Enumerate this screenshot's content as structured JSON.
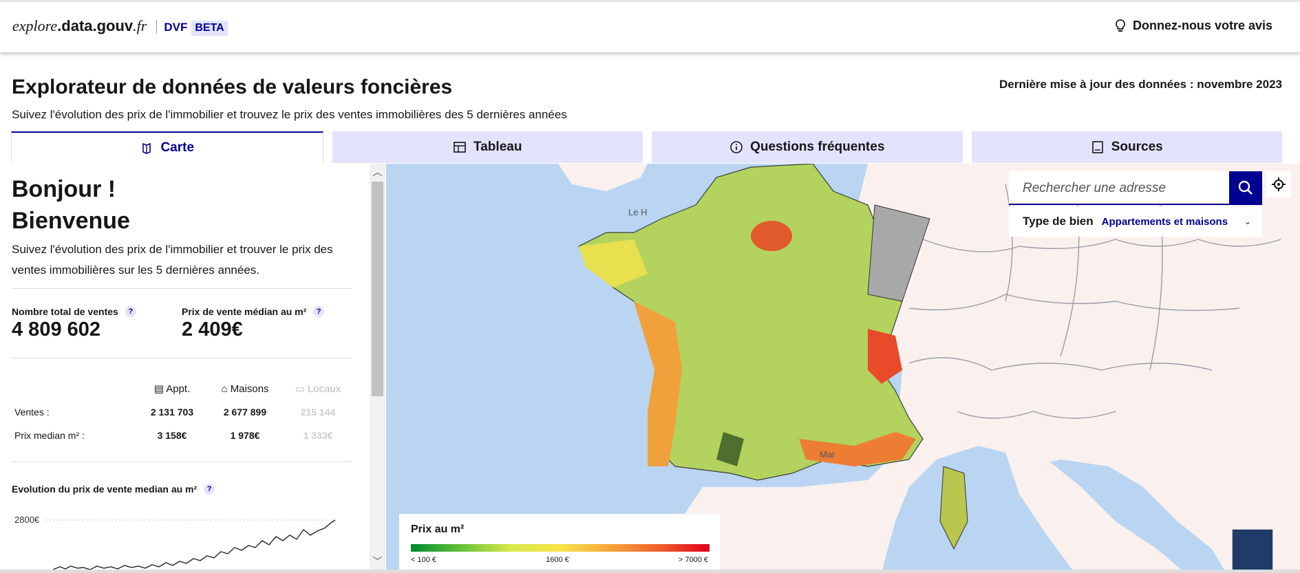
{
  "header": {
    "logo_italic": "explore",
    "logo_bold": ".data.gouv",
    "logo_suffix": ".fr",
    "product": "DVF",
    "badge": "BETA",
    "feedback": "Donnez-nous votre avis"
  },
  "page": {
    "title": "Explorateur de données de valeurs foncières",
    "subtitle": "Suivez l'évolution des prix de l'immobilier et trouvez le prix des ventes immobilières des 5 dernières années",
    "update_note": "Dernière mise à jour des données : novembre 2023"
  },
  "tabs": [
    {
      "label": "Carte",
      "icon": "map-icon",
      "active": true
    },
    {
      "label": "Tableau",
      "icon": "table-icon",
      "active": false
    },
    {
      "label": "Questions fréquentes",
      "icon": "info-icon",
      "active": false
    },
    {
      "label": "Sources",
      "icon": "book-icon",
      "active": false
    }
  ],
  "panel": {
    "greeting_line1": "Bonjour !",
    "greeting_line2": "Bienvenue",
    "intro": "Suivez l'évolution des prix de l'immobilier et trouver le prix des ventes immobilières sur les 5 dernières années.",
    "total_sales_label": "Nombre total de ventes",
    "total_sales_value": "4 809 602",
    "median_price_label": "Prix de vente médian au m²",
    "median_price_value": "2 409€",
    "help": "?",
    "table": {
      "columns": [
        "Appt.",
        "Maisons",
        "Locaux"
      ],
      "rows": [
        {
          "label": "Ventes :",
          "values": [
            "2 131 703",
            "2 677 899",
            "215 144"
          ]
        },
        {
          "label": "Prix median m² :",
          "values": [
            "3 158€",
            "1 978€",
            "1 333€"
          ]
        }
      ]
    },
    "evolution_title": "Evolution du prix de vente median au m²",
    "evolution_axis_label": "2800€"
  },
  "map": {
    "search_placeholder": "Rechercher une adresse",
    "type_label": "Type de bien",
    "type_value": "Appartements et maisons",
    "city_label_1": "Le H",
    "city_label_2": "Mar",
    "legend_title": "Prix au m²",
    "legend_min": "< 100 €",
    "legend_mid": "1600 €",
    "legend_max": "> 7000 €"
  }
}
